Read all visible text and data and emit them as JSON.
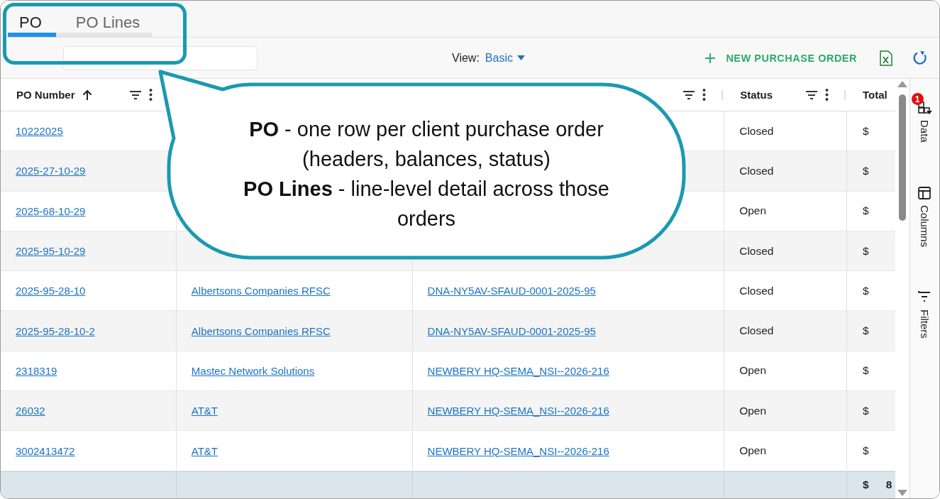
{
  "tabs": [
    {
      "label": "PO",
      "selected": true
    },
    {
      "label": "PO Lines",
      "selected": false
    }
  ],
  "toolbar": {
    "view_label": "View:",
    "view_value": "Basic",
    "new_button": "NEW PURCHASE ORDER"
  },
  "table": {
    "columns": [
      {
        "kind": "text",
        "label": "PO Number",
        "sorted": true,
        "menu": true
      },
      {
        "kind": "blank"
      },
      {
        "kind": "blank",
        "menu": true
      },
      {
        "kind": "text",
        "label": "Status",
        "menu": true
      },
      {
        "kind": "text",
        "label": "Total"
      }
    ],
    "rows": [
      {
        "po_number": "10222025",
        "status": "Closed",
        "total": "$"
      },
      {
        "po_number": "2025-27-10-29",
        "status": "Closed",
        "total": "$"
      },
      {
        "po_number": "2025-68-10-29",
        "status": "Open",
        "total": "$"
      },
      {
        "po_number": "2025-95-10-29",
        "status": "Closed",
        "total": "$"
      },
      {
        "po_number": "2025-95-28-10",
        "customer": "Albertsons Companies RFSC",
        "project": "DNA-NY5AV-SFAUD-0001-2025-95",
        "status": "Closed",
        "total": "$"
      },
      {
        "po_number": "2025-95-28-10-2",
        "customer": "Albertsons Companies RFSC",
        "project": "DNA-NY5AV-SFAUD-0001-2025-95",
        "status": "Closed",
        "total": "$"
      },
      {
        "po_number": "2318319",
        "customer": "Mastec Network Solutions",
        "project": "NEWBERY HQ-SEMA_NSI--2026-216",
        "status": "Open",
        "total": "$"
      },
      {
        "po_number": "26032",
        "customer": "AT&T",
        "project": "NEWBERY HQ-SEMA_NSI--2026-216",
        "status": "Open",
        "total": "$"
      },
      {
        "po_number": "3002413472",
        "customer": "AT&T",
        "project": "NEWBERY HQ-SEMA_NSI--2026-216",
        "status": "Open",
        "total": "$"
      }
    ],
    "footer": {
      "total_currency": "$",
      "total_value": "8"
    }
  },
  "side_panel": [
    {
      "kind": "data",
      "label": "Data",
      "badge": "1"
    },
    {
      "kind": "columns",
      "label": "Columns"
    },
    {
      "kind": "filters",
      "label": "Filters"
    }
  ],
  "callout": {
    "lines": [
      "**PO** - one row per client purchase order (headers, balances, status)",
      "**PO Lines** - line-level detail across those orders"
    ]
  }
}
